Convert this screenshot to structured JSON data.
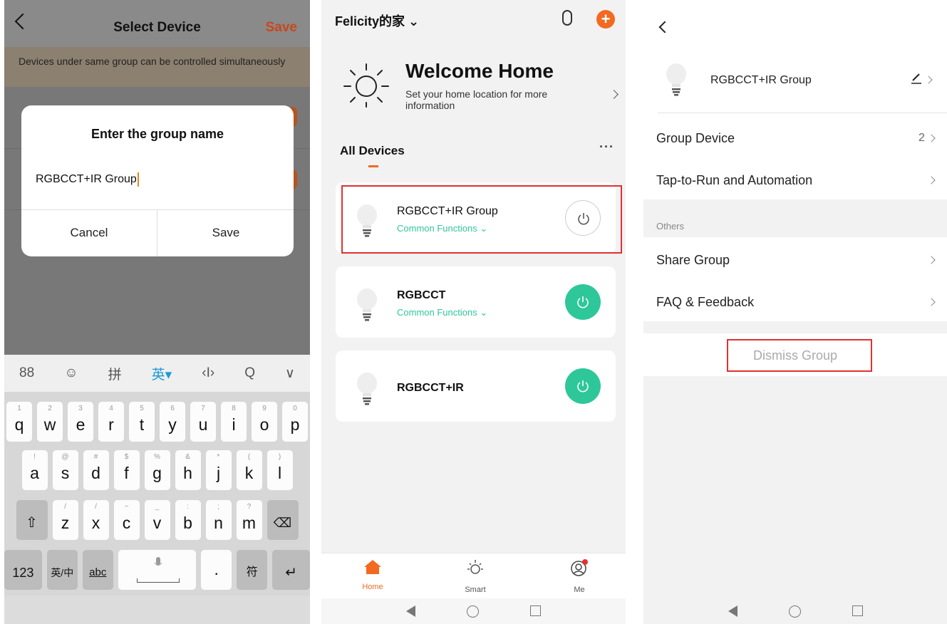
{
  "panel1": {
    "title": "Select Device",
    "save_label": "Save",
    "note": "Devices under same group can be controlled simultaneously",
    "dialog": {
      "title": "Enter the group name",
      "input_value": "RGBCCT+IR Group",
      "cancel_label": "Cancel",
      "save_label": "Save"
    },
    "keyboard": {
      "toolbar": [
        "88",
        "☺",
        "拼",
        "英▾",
        "‹I›",
        "Q",
        "∨"
      ],
      "row1": [
        [
          "q",
          "1"
        ],
        [
          "w",
          "2"
        ],
        [
          "e",
          "3"
        ],
        [
          "r",
          "4"
        ],
        [
          "t",
          "5"
        ],
        [
          "y",
          "6"
        ],
        [
          "u",
          "7"
        ],
        [
          "i",
          "8"
        ],
        [
          "o",
          "9"
        ],
        [
          "p",
          "0"
        ]
      ],
      "row2": [
        [
          "a",
          "!"
        ],
        [
          "s",
          "@"
        ],
        [
          "d",
          "#"
        ],
        [
          "f",
          "$"
        ],
        [
          "g",
          "%"
        ],
        [
          "h",
          "&"
        ],
        [
          "j",
          "*"
        ],
        [
          "k",
          "("
        ],
        [
          "l",
          ")"
        ]
      ],
      "row3": [
        [
          "z",
          "/"
        ],
        [
          "x",
          "/"
        ],
        [
          "c",
          "−"
        ],
        [
          "v",
          "_"
        ],
        [
          "b",
          ":"
        ],
        [
          "n",
          ";"
        ],
        [
          "m",
          "?"
        ]
      ],
      "shift": "⇧",
      "backspace": "⌫",
      "row4": {
        "num": "123",
        "lang": "英/中",
        "abc": "abc",
        "dot": "·",
        "sym": "符",
        "enter": "↵"
      }
    }
  },
  "panel2": {
    "home_name": "Felicity的家 ⌄",
    "welcome_title": "Welcome Home",
    "welcome_subtitle": "Set your home location for more information",
    "all_devices": "All Devices",
    "more": "···",
    "devices": [
      {
        "name": "RGBCCT+IR Group",
        "func": "Common Functions ⌄",
        "on": false
      },
      {
        "name": "RGBCCT",
        "func": "Common Functions ⌄",
        "on": true
      },
      {
        "name": "RGBCCT+IR",
        "func": "",
        "on": true
      }
    ],
    "tabs": [
      {
        "label": "Home",
        "active": true
      },
      {
        "label": "Smart",
        "active": false
      },
      {
        "label": "Me",
        "active": false
      }
    ],
    "accent": "#f26a22",
    "on_color": "#2ec79a"
  },
  "panel3": {
    "group_name": "RGBCCT+IR Group",
    "rows": [
      {
        "label": "Group Device",
        "count": "2"
      },
      {
        "label": "Tap-to-Run and Automation",
        "count": ""
      }
    ],
    "others_label": "Others",
    "rows2": [
      {
        "label": "Share Group"
      },
      {
        "label": "FAQ & Feedback"
      }
    ],
    "dismiss_label": "Dismiss Group"
  }
}
